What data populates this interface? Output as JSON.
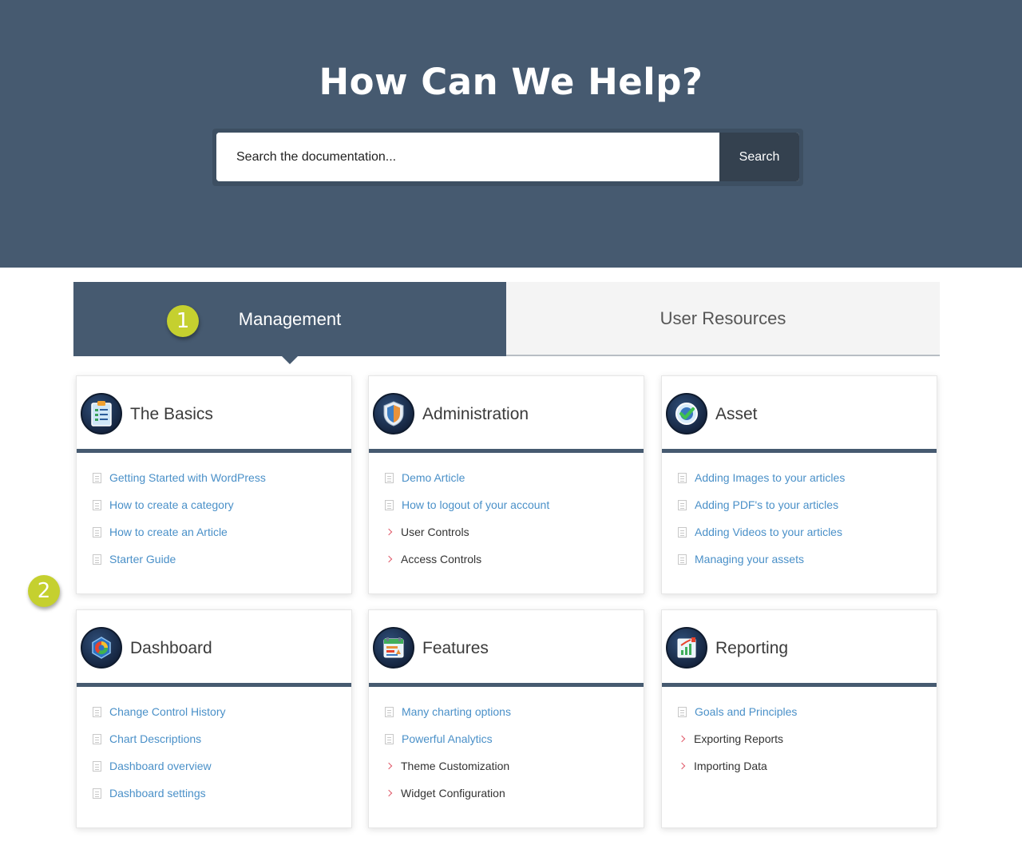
{
  "hero": {
    "title": "How Can We Help?",
    "search_placeholder": "Search the documentation...",
    "search_button": "Search"
  },
  "tabs": [
    {
      "label": "Management",
      "active": true
    },
    {
      "label": "User Resources",
      "active": false
    }
  ],
  "markers": [
    "1",
    "2"
  ],
  "colors": {
    "accent": "#465a70",
    "link": "#4a90c8",
    "marker": "#c5d02f"
  },
  "cards": [
    {
      "title": "The Basics",
      "icon": "clipboard-icon",
      "items": [
        {
          "label": "Getting Started with WordPress",
          "type": "article"
        },
        {
          "label": "How to create a category",
          "type": "article"
        },
        {
          "label": "How to create an Article",
          "type": "article"
        },
        {
          "label": "Starter Guide",
          "type": "article"
        }
      ]
    },
    {
      "title": "Administration",
      "icon": "shield-icon",
      "items": [
        {
          "label": "Demo Article",
          "type": "article"
        },
        {
          "label": "How to logout of your account",
          "type": "article"
        },
        {
          "label": "User Controls",
          "type": "category"
        },
        {
          "label": "Access Controls",
          "type": "category"
        }
      ]
    },
    {
      "title": "Asset",
      "icon": "checkmark-icon",
      "items": [
        {
          "label": "Adding Images to your articles",
          "type": "article"
        },
        {
          "label": "Adding PDF's to your articles",
          "type": "article"
        },
        {
          "label": "Adding Videos to your articles",
          "type": "article"
        },
        {
          "label": "Managing your assets",
          "type": "article"
        }
      ]
    },
    {
      "title": "Dashboard",
      "icon": "pie-chart-icon",
      "items": [
        {
          "label": "Change Control History",
          "type": "article"
        },
        {
          "label": "Chart Descriptions",
          "type": "article"
        },
        {
          "label": "Dashboard overview",
          "type": "article"
        },
        {
          "label": "Dashboard settings",
          "type": "article"
        }
      ]
    },
    {
      "title": "Features",
      "icon": "calendar-icon",
      "items": [
        {
          "label": "Many charting options",
          "type": "article"
        },
        {
          "label": "Powerful Analytics",
          "type": "article"
        },
        {
          "label": "Theme Customization",
          "type": "category"
        },
        {
          "label": "Widget Configuration",
          "type": "category"
        }
      ]
    },
    {
      "title": "Reporting",
      "icon": "bar-chart-icon",
      "items": [
        {
          "label": "Goals and Principles",
          "type": "article"
        },
        {
          "label": "Exporting Reports",
          "type": "category"
        },
        {
          "label": "Importing Data",
          "type": "category"
        }
      ]
    }
  ]
}
